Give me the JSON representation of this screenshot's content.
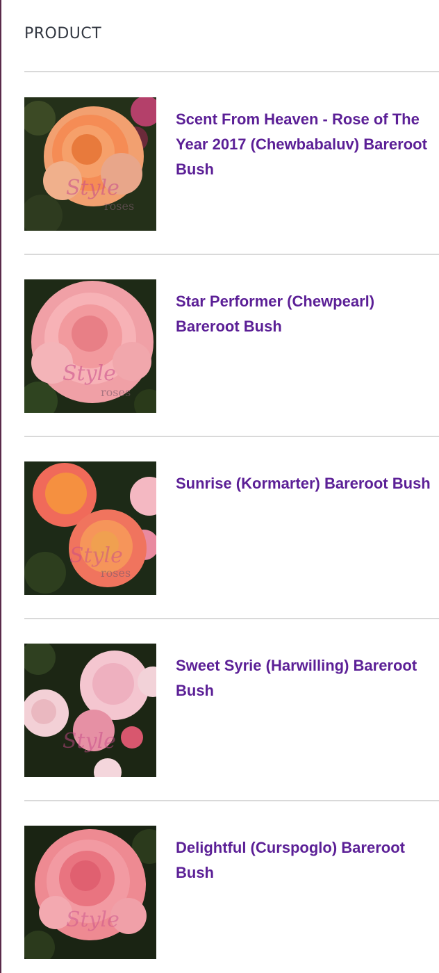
{
  "table": {
    "header": "PRODUCT",
    "products": [
      {
        "title": "Scent From Heaven - Rose of The Year 2017 (Chewbabaluv) Bareroot Bush",
        "image": "orange-rose-image",
        "watermark": "Style roses"
      },
      {
        "title": "Star Performer (Chewpearl) Bareroot Bush",
        "image": "pink-rose-image",
        "watermark": "Style roses"
      },
      {
        "title": "Sunrise (Kormarter) Bareroot Bush",
        "image": "coral-rose-image",
        "watermark": "Style roses"
      },
      {
        "title": "Sweet Syrie (Harwilling) Bareroot Bush",
        "image": "pale-pink-rose-image",
        "watermark": "Style roses"
      },
      {
        "title": "Delightful (Curspoglo) Bareroot Bush",
        "image": "salmon-pink-rose-image",
        "watermark": "Style roses"
      }
    ]
  },
  "colors": {
    "product_link": "#5b1f96",
    "header_text": "#333842",
    "divider": "#d9d9d9",
    "left_edge": "#5a2a4a"
  }
}
